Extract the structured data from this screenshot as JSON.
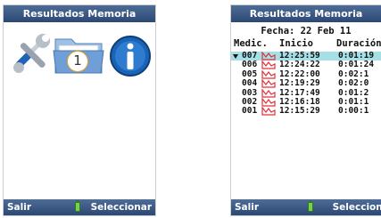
{
  "left_screen": {
    "title": "Resultados Memoria",
    "icons": [
      "tools-icon",
      "folder-icon",
      "info-icon"
    ],
    "selection_badge": "1",
    "softkey_left": "Salir",
    "softkey_right": "Seleccionar"
  },
  "right_screen": {
    "title": "Resultados Memoria",
    "date_line": "Fecha: 22 Feb 11",
    "columns": {
      "medic": "Medic.",
      "inicio": "Inicio",
      "duracion": "Duración"
    },
    "records": [
      {
        "num": "007",
        "start": "12:25:59",
        "duration": "0:01:19"
      },
      {
        "num": "006",
        "start": "12:24:22",
        "duration": "0:01:24"
      },
      {
        "num": "005",
        "start": "12:22:00",
        "duration": "0:02:1"
      },
      {
        "num": "004",
        "start": "12:19:29",
        "duration": "0:02:0"
      },
      {
        "num": "003",
        "start": "12:17:49",
        "duration": "0:01:2"
      },
      {
        "num": "002",
        "start": "12:16:18",
        "duration": "0:01:1"
      },
      {
        "num": "001",
        "start": "12:15:29",
        "duration": "0:00:1"
      }
    ],
    "softkey_left": "Salir",
    "softkey_right": "Seleccionar"
  },
  "colors": {
    "bar": "#2c4874",
    "selected_row": "#a6dfe6",
    "chart_icon": "#e0303a",
    "battery": "#7ccf4a"
  }
}
